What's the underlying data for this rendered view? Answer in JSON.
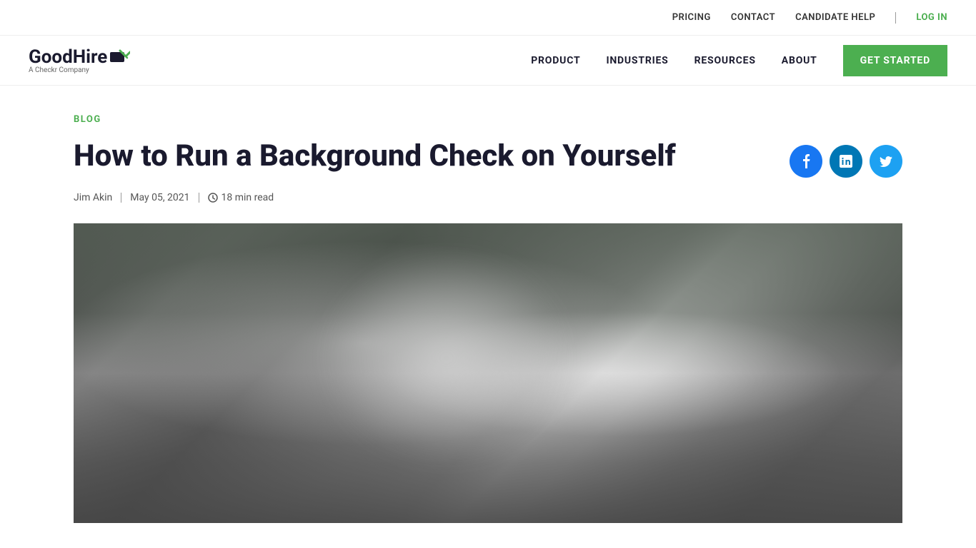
{
  "topBar": {
    "pricing": "PRICING",
    "contact": "CONTACT",
    "candidateHelp": "CANDIDATE HELP",
    "login": "LOG IN"
  },
  "nav": {
    "logoName": "GoodHire",
    "logoTagline": "A Checkr Company",
    "product": "PRODUCT",
    "industries": "INDUSTRIES",
    "resources": "RESOURCES",
    "about": "ABOUT",
    "getStarted": "GET STARTED"
  },
  "article": {
    "blogLabel": "BLOG",
    "title": "How to Run a Background Check on Yourself",
    "author": "Jim Akin",
    "date": "May 05, 2021",
    "readTime": "18 min read",
    "social": {
      "facebook": "f",
      "linkedin": "in",
      "twitter": "t"
    }
  }
}
